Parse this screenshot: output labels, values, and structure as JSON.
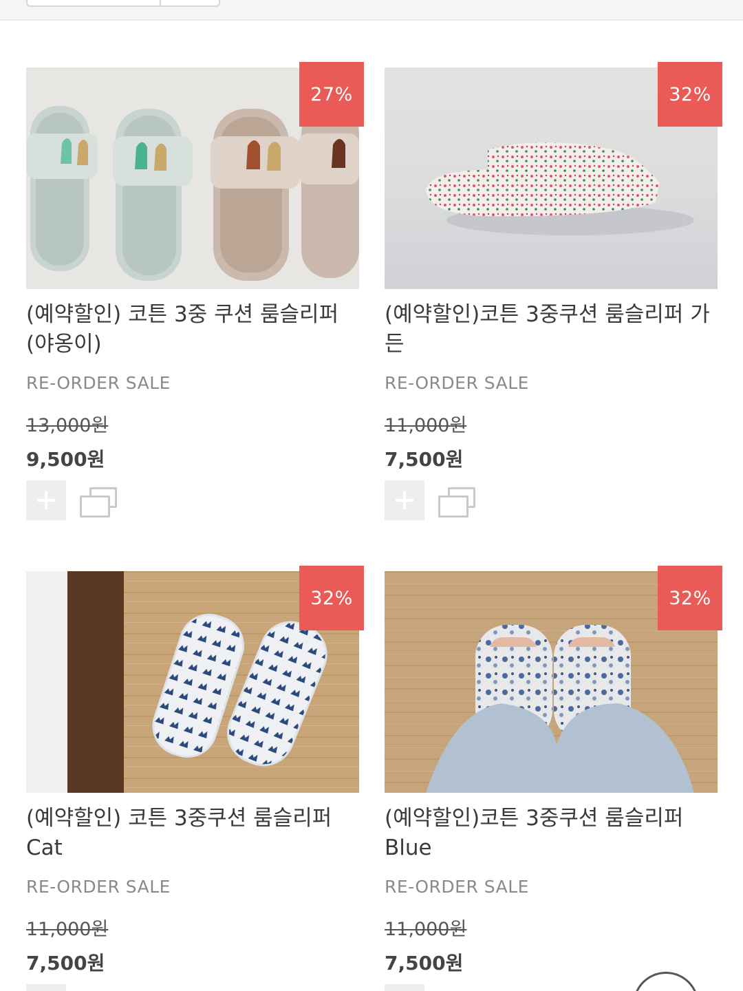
{
  "products": [
    {
      "name": "(예약할인) 코튼 3중 쿠션 룸슬리퍼 (야옹이)",
      "discount": "27%",
      "label": "RE-ORDER SALE",
      "original_price": "13,000원",
      "sale_price": "9,500원",
      "image_icon": "slipper-cat-embroidery-image"
    },
    {
      "name": "(예약할인)코튼 3중쿠션 룸슬리퍼 가든",
      "discount": "32%",
      "label": "RE-ORDER SALE",
      "original_price": "11,000원",
      "sale_price": "7,500원",
      "image_icon": "slipper-floral-image"
    },
    {
      "name": "(예약할인) 코튼 3중쿠션 룸슬리퍼 Cat",
      "discount": "32%",
      "label": "RE-ORDER SALE",
      "original_price": "11,000원",
      "sale_price": "7,500원",
      "image_icon": "slipper-cat-print-image"
    },
    {
      "name": "(예약할인)코튼 3중쿠션 룸슬리퍼 Blue",
      "discount": "32%",
      "label": "RE-ORDER SALE",
      "original_price": "11,000원",
      "sale_price": "7,500원",
      "image_icon": "slipper-blue-floral-image"
    }
  ],
  "colors": {
    "badge": "#ea5a57",
    "label": "#8a8a8a",
    "button_bg": "#eeeeee"
  }
}
